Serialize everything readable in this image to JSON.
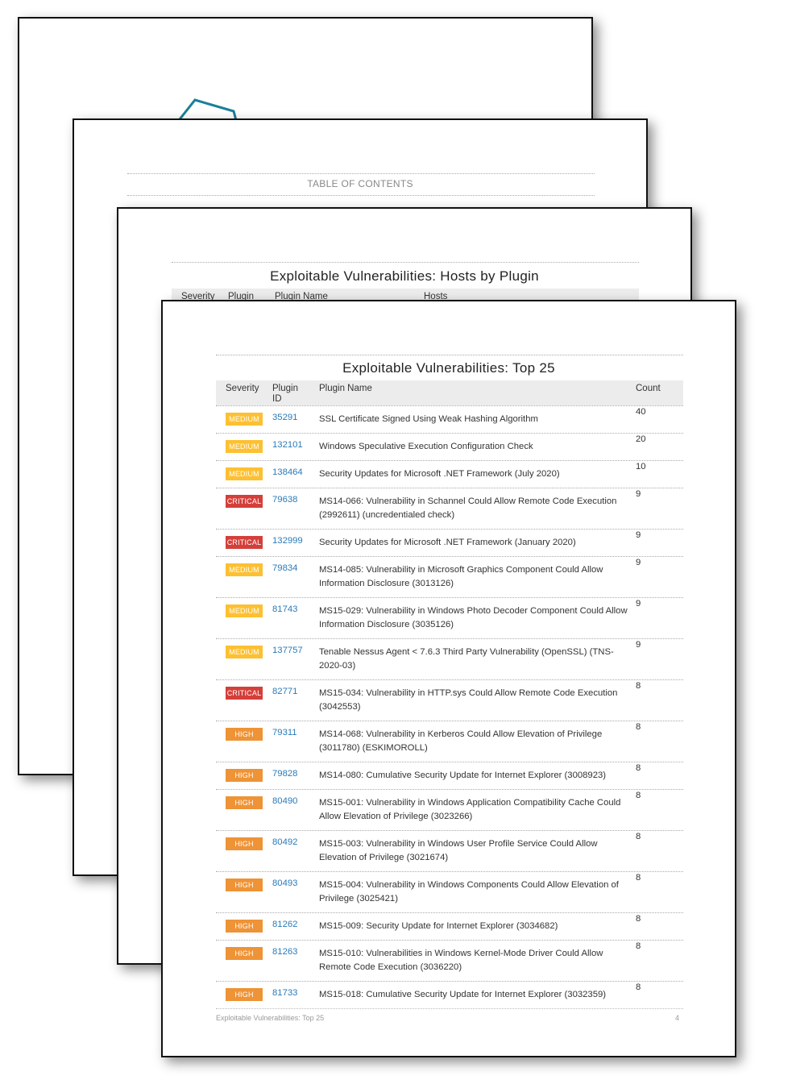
{
  "pages": {
    "cover": {},
    "toc": {
      "title": "TABLE OF CONTENTS"
    },
    "hosts_by_plugin": {
      "title": "Exploitable Vulnerabilities: Hosts by Plugin",
      "columns": [
        "Severity",
        "Plugin",
        "Plugin Name",
        "Hosts"
      ]
    },
    "top25": {
      "title": "Exploitable Vulnerabilities: Top 25",
      "columns": {
        "severity": "Severity",
        "plugin_id": "Plugin ID",
        "plugin_name": "Plugin Name",
        "count": "Count"
      },
      "rows": [
        {
          "severity": "MEDIUM",
          "level": "medium",
          "plugin_id": "35291",
          "plugin_name": "SSL Certificate Signed Using Weak Hashing Algorithm",
          "count": "40"
        },
        {
          "severity": "MEDIUM",
          "level": "medium",
          "plugin_id": "132101",
          "plugin_name": "Windows Speculative Execution Configuration Check",
          "count": "20"
        },
        {
          "severity": "MEDIUM",
          "level": "medium",
          "plugin_id": "138464",
          "plugin_name": "Security Updates for Microsoft .NET Framework (July 2020)",
          "count": "10"
        },
        {
          "severity": "CRITICAL",
          "level": "critical",
          "plugin_id": "79638",
          "plugin_name": "MS14-066: Vulnerability in Schannel Could Allow Remote Code Execution (2992611) (uncredentialed check)",
          "count": "9"
        },
        {
          "severity": "CRITICAL",
          "level": "critical",
          "plugin_id": "132999",
          "plugin_name": "Security Updates for Microsoft .NET Framework (January 2020)",
          "count": "9"
        },
        {
          "severity": "MEDIUM",
          "level": "medium",
          "plugin_id": "79834",
          "plugin_name": "MS14-085: Vulnerability in Microsoft Graphics Component Could Allow Information Disclosure (3013126)",
          "count": "9"
        },
        {
          "severity": "MEDIUM",
          "level": "medium",
          "plugin_id": "81743",
          "plugin_name": "MS15-029: Vulnerability in Windows Photo Decoder Component Could Allow Information Disclosure (3035126)",
          "count": "9"
        },
        {
          "severity": "MEDIUM",
          "level": "medium",
          "plugin_id": "137757",
          "plugin_name": "Tenable Nessus Agent < 7.6.3 Third Party Vulnerability (OpenSSL) (TNS-2020-03)",
          "count": "9"
        },
        {
          "severity": "CRITICAL",
          "level": "critical",
          "plugin_id": "82771",
          "plugin_name": "MS15-034: Vulnerability in HTTP.sys Could Allow Remote Code Execution (3042553)",
          "count": "8"
        },
        {
          "severity": "HIGH",
          "level": "high",
          "plugin_id": "79311",
          "plugin_name": "MS14-068: Vulnerability in Kerberos Could Allow Elevation of Privilege (3011780) (ESKIMOROLL)",
          "count": "8"
        },
        {
          "severity": "HIGH",
          "level": "high",
          "plugin_id": "79828",
          "plugin_name": "MS14-080: Cumulative Security Update for Internet Explorer (3008923)",
          "count": "8"
        },
        {
          "severity": "HIGH",
          "level": "high",
          "plugin_id": "80490",
          "plugin_name": "MS15-001: Vulnerability in Windows Application Compatibility Cache Could Allow Elevation of Privilege (3023266)",
          "count": "8"
        },
        {
          "severity": "HIGH",
          "level": "high",
          "plugin_id": "80492",
          "plugin_name": "MS15-003: Vulnerability in Windows User Profile Service Could Allow Elevation of Privilege (3021674)",
          "count": "8"
        },
        {
          "severity": "HIGH",
          "level": "high",
          "plugin_id": "80493",
          "plugin_name": "MS15-004: Vulnerability in Windows Components Could Allow Elevation of Privilege (3025421)",
          "count": "8"
        },
        {
          "severity": "HIGH",
          "level": "high",
          "plugin_id": "81262",
          "plugin_name": "MS15-009: Security Update for Internet Explorer (3034682)",
          "count": "8"
        },
        {
          "severity": "HIGH",
          "level": "high",
          "plugin_id": "81263",
          "plugin_name": "MS15-010: Vulnerabilities in Windows Kernel-Mode Driver Could Allow Remote Code Execution (3036220)",
          "count": "8"
        },
        {
          "severity": "HIGH",
          "level": "high",
          "plugin_id": "81733",
          "plugin_name": "MS15-018: Cumulative Security Update for Internet Explorer (3032359)",
          "count": "8"
        }
      ],
      "footer": {
        "title": "Exploitable Vulnerabilities: Top 25",
        "page_number": "4"
      }
    }
  },
  "colors": {
    "medium": "#fdc031",
    "critical": "#d43f3a",
    "high": "#ee9336",
    "link": "#2a7ab8",
    "logo": "#1a7f9a"
  }
}
